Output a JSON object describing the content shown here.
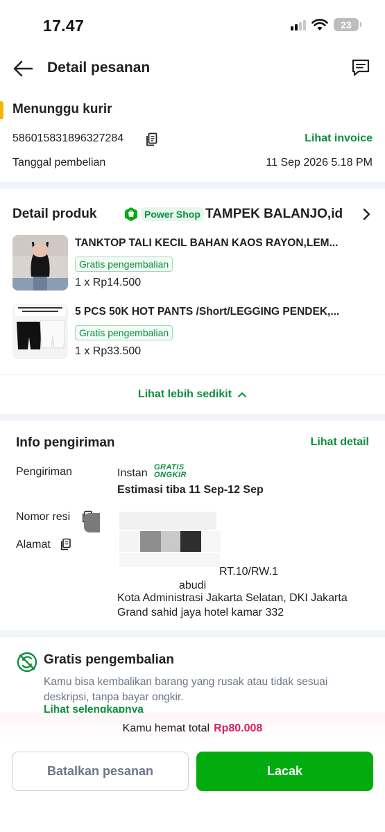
{
  "status_bar": {
    "time": "17.47",
    "battery": "23"
  },
  "header": {
    "title": "Detail pesanan"
  },
  "order": {
    "status": "Menunggu kurir",
    "number": "586015831896327284",
    "invoice_link": "Lihat invoice",
    "purchase_label": "Tanggal pembelian",
    "purchase_date": "11 Sep 2026 5.18 PM"
  },
  "products": {
    "section_title": "Detail produk",
    "power_shop_label": "Power Shop",
    "shop_name": "TAMPEK BALANJO,id",
    "items": [
      {
        "name": "TANKTOP TALI KECIL BAHAN KAOS RAYON,LEM...",
        "badge": "Gratis pengembalian",
        "price": "1 x Rp14.500"
      },
      {
        "name": "5 PCS 50K HOT PANTS /Short/LEGGING PENDEK,...",
        "badge": "Gratis pengembalian",
        "price": "1 x Rp33.500"
      }
    ],
    "see_less": "Lihat lebih sedikit"
  },
  "shipping": {
    "title": "Info pengiriman",
    "detail_link": "Lihat detail",
    "method_label": "Pengiriman",
    "method_value": "Instan",
    "free_ongkir_line1": "GRATIS",
    "free_ongkir_line2": "ONGKIR",
    "eta": "Estimasi tiba 11 Sep-12 Sep",
    "resi_label": "Nomor resi",
    "address_label": "Alamat",
    "address_lines": [
      "RT.10/RW.1",
      "abudi",
      "Kota Administrasi Jakarta Selatan, DKI Jakarta",
      "Grand sahid jaya hotel kamar 332"
    ]
  },
  "free_return": {
    "title": "Gratis pengembalian",
    "description": "Kamu bisa kembalikan barang yang rusak atau tidak sesuai deskripsi, tanpa bayar ongkir.",
    "link": "Lihat selengkapnya"
  },
  "footer": {
    "savings_label": "Kamu hemat total",
    "savings_amount": "Rp80.008",
    "cancel_label": "Batalkan pesanan",
    "track_label": "Lacak"
  },
  "colors": {
    "accent_green": "#03ac0e",
    "link_green": "#0a8f3c",
    "savings_pink": "#d6215b",
    "status_yellow": "#f7b500"
  }
}
